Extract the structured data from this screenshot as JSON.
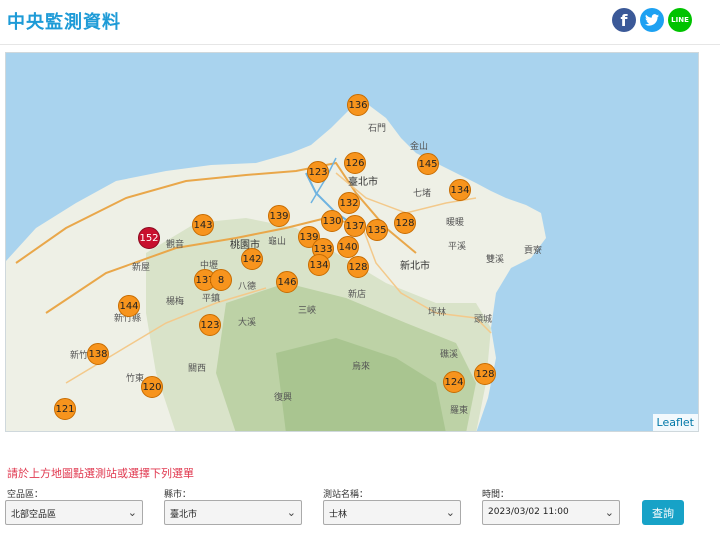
{
  "page": {
    "title": "中央監測資料"
  },
  "social": {
    "facebook": "f",
    "twitter": "🐦",
    "line": "LINE"
  },
  "map": {
    "attribution": "Leaflet",
    "places": [
      {
        "name": "石門",
        "cls": ""
      },
      {
        "name": "金山",
        "cls": ""
      },
      {
        "name": "臺北市",
        "cls": "city"
      },
      {
        "name": "七堵",
        "cls": ""
      },
      {
        "name": "暖暖",
        "cls": ""
      },
      {
        "name": "平溪",
        "cls": ""
      },
      {
        "name": "雙溪",
        "cls": ""
      },
      {
        "name": "貢寮",
        "cls": ""
      },
      {
        "name": "新北市",
        "cls": "city"
      },
      {
        "name": "觀音",
        "cls": ""
      },
      {
        "name": "桃園市",
        "cls": "city"
      },
      {
        "name": "龜山",
        "cls": ""
      },
      {
        "name": "新屋",
        "cls": ""
      },
      {
        "name": "中壢",
        "cls": ""
      },
      {
        "name": "八德",
        "cls": ""
      },
      {
        "name": "平鎮",
        "cls": ""
      },
      {
        "name": "楊梅",
        "cls": ""
      },
      {
        "name": "新竹縣",
        "cls": ""
      },
      {
        "name": "新竹市",
        "cls": ""
      },
      {
        "name": "竹東",
        "cls": ""
      },
      {
        "name": "關西",
        "cls": ""
      },
      {
        "name": "大溪",
        "cls": ""
      },
      {
        "name": "三峽",
        "cls": ""
      },
      {
        "name": "新店",
        "cls": ""
      },
      {
        "name": "坪林",
        "cls": ""
      },
      {
        "name": "頭城",
        "cls": ""
      },
      {
        "name": "烏來",
        "cls": ""
      },
      {
        "name": "礁溪",
        "cls": ""
      },
      {
        "name": "復興",
        "cls": ""
      },
      {
        "name": "羅東",
        "cls": ""
      }
    ],
    "markers": [
      {
        "value": "136",
        "level": "mod"
      },
      {
        "value": "126",
        "level": "mod"
      },
      {
        "value": "145",
        "level": "mod"
      },
      {
        "value": "123",
        "level": "mod"
      },
      {
        "value": "134",
        "level": "mod"
      },
      {
        "value": "132",
        "level": "mod"
      },
      {
        "value": "139",
        "level": "mod"
      },
      {
        "value": "143",
        "level": "mod"
      },
      {
        "value": "152",
        "level": "high"
      },
      {
        "value": "130",
        "level": "mod"
      },
      {
        "value": "137",
        "level": "mod"
      },
      {
        "value": "128",
        "level": "mod"
      },
      {
        "value": "139",
        "level": "mod"
      },
      {
        "value": "135",
        "level": "mod"
      },
      {
        "value": "133",
        "level": "mod"
      },
      {
        "value": "140",
        "level": "mod"
      },
      {
        "value": "142",
        "level": "mod"
      },
      {
        "value": "134",
        "level": "mod"
      },
      {
        "value": "128",
        "level": "mod"
      },
      {
        "value": "146",
        "level": "mod"
      },
      {
        "value": "137",
        "level": "mod"
      },
      {
        "value": "8",
        "level": "mod"
      },
      {
        "value": "144",
        "level": "mod"
      },
      {
        "value": "123",
        "level": "mod"
      },
      {
        "value": "138",
        "level": "mod"
      },
      {
        "value": "120",
        "level": "mod"
      },
      {
        "value": "124",
        "level": "mod"
      },
      {
        "value": "128",
        "level": "mod"
      },
      {
        "value": "121",
        "level": "mod"
      }
    ]
  },
  "form": {
    "instruction": "請於上方地圖點選測站或選擇下列選單",
    "fields": [
      {
        "label": "空品區：",
        "value": "北部空品區"
      },
      {
        "label": "縣市：",
        "value": "臺北市"
      },
      {
        "label": "測站名稱：",
        "value": "士林"
      },
      {
        "label": "時間：",
        "value": "2023/03/02 11:00"
      }
    ],
    "submit": "查詢"
  }
}
